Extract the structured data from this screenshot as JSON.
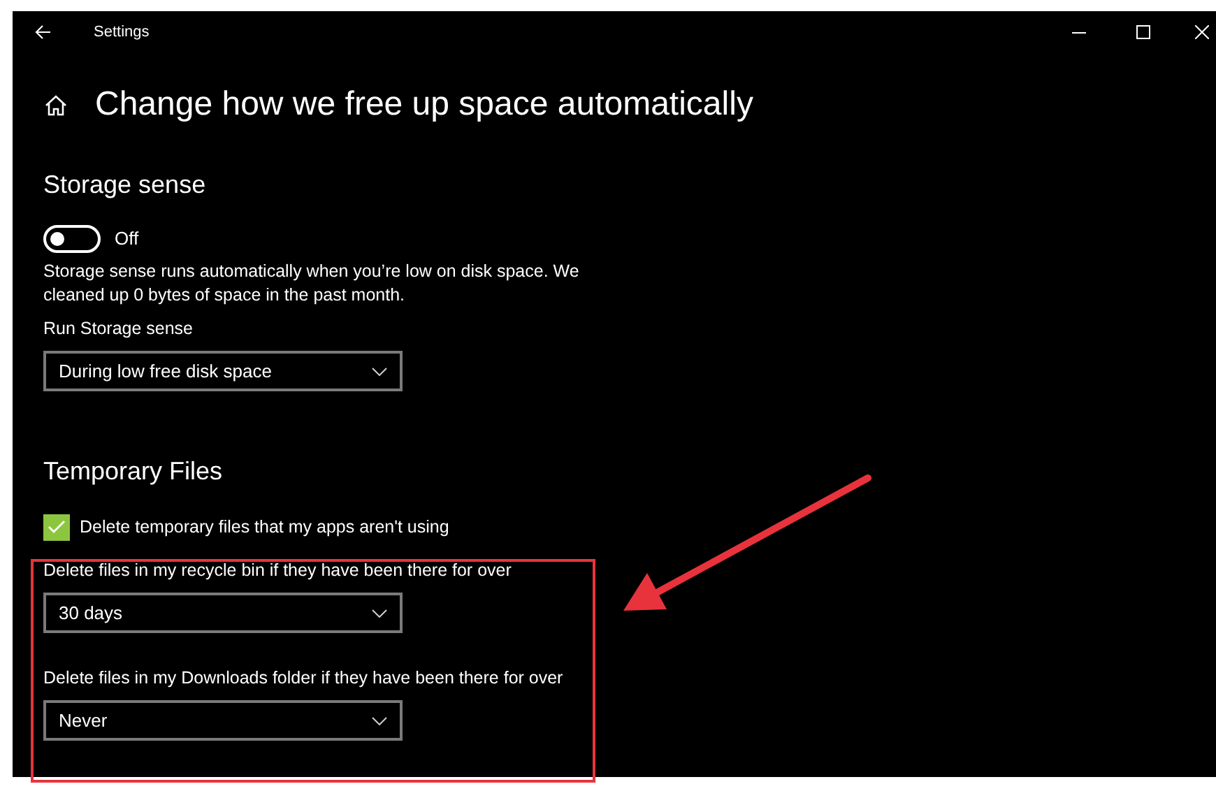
{
  "window": {
    "title": "Settings"
  },
  "page": {
    "title": "Change how we free up space automatically"
  },
  "sections": [
    {
      "heading": "Storage sense",
      "items": [
        {
          "kind": "toggle",
          "on": false,
          "label": "Off"
        },
        {
          "kind": "text",
          "text": "Storage sense runs automatically when you’re low on disk space. We cleaned up 0 bytes of space in the past month."
        },
        {
          "kind": "select",
          "label": "Run Storage sense",
          "value": "During low free disk space"
        }
      ]
    },
    {
      "heading": "Temporary Files",
      "items": [
        {
          "kind": "checkbox",
          "checked": true,
          "label": "Delete temporary files that my apps aren't using"
        },
        {
          "kind": "select",
          "label": "Delete files in my recycle bin if they have been there for over",
          "value": "30 days"
        },
        {
          "kind": "select",
          "label": "Delete files in my Downloads folder if they have been there for over",
          "value": "Never"
        }
      ]
    }
  ]
}
